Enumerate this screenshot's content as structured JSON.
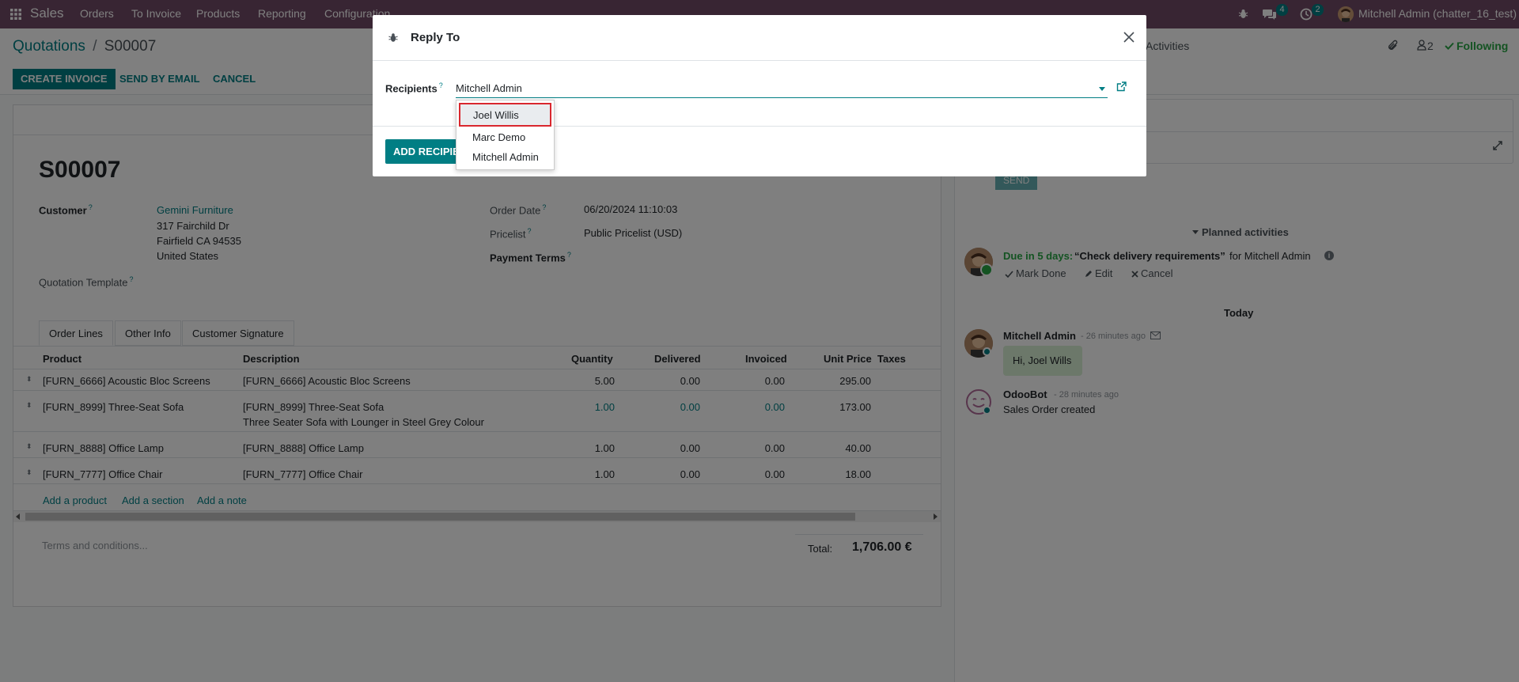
{
  "navbar": {
    "apps_icon": "grid-icon",
    "brand": "Sales",
    "menu": [
      "Orders",
      "To Invoice",
      "Products",
      "Reporting",
      "Configuration"
    ],
    "messages_count": "4",
    "activities_count": "2",
    "user": "Mitchell Admin (chatter_16_test)"
  },
  "control": {
    "breadcrumb_parent": "Quotations",
    "breadcrumb_sep": "/",
    "breadcrumb_current": "S00007",
    "buttons": {
      "create_invoice": "CREATE INVOICE",
      "send_by_email": "SEND BY EMAIL",
      "cancel": "CANCEL"
    },
    "activities_label": "Activities",
    "followers_count": "2",
    "following_label": "Following"
  },
  "form": {
    "name": "S00007",
    "customer_label": "Customer",
    "customer_name": "Gemini Furniture",
    "customer_address": [
      "317 Fairchild Dr",
      "Fairfield CA 94535",
      "United States"
    ],
    "quotation_template_label": "Quotation Template",
    "order_date_label": "Order Date",
    "order_date": "06/20/2024 11:10:03",
    "pricelist_label": "Pricelist",
    "pricelist": "Public Pricelist (USD)",
    "payment_terms_label": "Payment Terms",
    "help_mark": "?",
    "tabs": [
      "Order Lines",
      "Other Info",
      "Customer Signature"
    ],
    "columns": [
      "Product",
      "Description",
      "Quantity",
      "Delivered",
      "Invoiced",
      "Unit Price",
      "Taxes"
    ],
    "lines": [
      {
        "product": "[FURN_6666] Acoustic Bloc Screens",
        "description": "[FURN_6666] Acoustic Bloc Screens",
        "description2": "",
        "quantity": "5.00",
        "delivered": "0.00",
        "invoiced": "0.00",
        "unit_price": "295.00"
      },
      {
        "product": "[FURN_8999] Three-Seat Sofa",
        "description": "[FURN_8999] Three-Seat Sofa",
        "description2": "Three Seater Sofa with Lounger in Steel Grey Colour",
        "quantity": "1.00",
        "delivered": "0.00",
        "invoiced": "0.00",
        "unit_price": "173.00"
      },
      {
        "product": "[FURN_8888] Office Lamp",
        "description": "[FURN_8888] Office Lamp",
        "description2": "",
        "quantity": "1.00",
        "delivered": "0.00",
        "invoiced": "0.00",
        "unit_price": "40.00"
      },
      {
        "product": "[FURN_7777] Office Chair",
        "description": "[FURN_7777] Office Chair",
        "description2": "",
        "quantity": "1.00",
        "delivered": "0.00",
        "invoiced": "0.00",
        "unit_price": "18.00"
      }
    ],
    "add_product": "Add a product",
    "add_section": "Add a section",
    "add_note": "Add a note",
    "terms_placeholder": "Terms and conditions...",
    "total_label": "Total:",
    "total_value": "1,706.00 €"
  },
  "chatter": {
    "send_label": "SEND",
    "planned_activities": "Planned activities",
    "activity": {
      "due": "Due in 5 days:",
      "summary": "“Check delivery requirements”",
      "for": "for Mitchell Admin",
      "mark_done": "Mark Done",
      "edit": "Edit",
      "cancel": "Cancel"
    },
    "today_label": "Today",
    "messages": [
      {
        "author": "Mitchell Admin",
        "time": "- 26 minutes ago",
        "body": "Hi, Joel Wills"
      },
      {
        "author": "OdooBot",
        "time": "- 28 minutes ago",
        "body": "Sales Order created"
      }
    ]
  },
  "modal": {
    "title": "Reply To",
    "recipients_label": "Recipients",
    "help_mark": "?",
    "recipients_value": "Mitchell Admin",
    "add_recipients_button": "ADD RECIPIE",
    "dropdown_options": [
      "Joel Willis",
      "Marc Demo",
      "Mitchell Admin"
    ],
    "highlighted_option": "Joel Willis"
  }
}
